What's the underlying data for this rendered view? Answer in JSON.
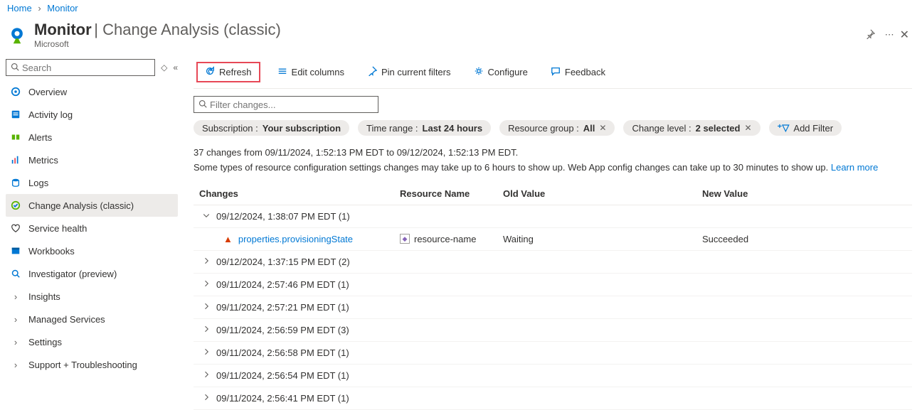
{
  "breadcrumb": {
    "home": "Home",
    "monitor": "Monitor"
  },
  "header": {
    "title": "Monitor",
    "subtitle": "Change Analysis (classic)",
    "publisher": "Microsoft"
  },
  "sidebar": {
    "searchPlaceholder": "Search",
    "items": [
      {
        "icon": "overview",
        "label": "Overview"
      },
      {
        "icon": "activity",
        "label": "Activity log"
      },
      {
        "icon": "alerts",
        "label": "Alerts"
      },
      {
        "icon": "metrics",
        "label": "Metrics"
      },
      {
        "icon": "logs",
        "label": "Logs"
      },
      {
        "icon": "change",
        "label": "Change Analysis (classic)",
        "active": true
      },
      {
        "icon": "health",
        "label": "Service health"
      },
      {
        "icon": "workbooks",
        "label": "Workbooks"
      },
      {
        "icon": "investigator",
        "label": "Investigator (preview)"
      },
      {
        "icon": "chevron",
        "label": "Insights"
      },
      {
        "icon": "chevron",
        "label": "Managed Services"
      },
      {
        "icon": "chevron",
        "label": "Settings"
      },
      {
        "icon": "chevron",
        "label": "Support + Troubleshooting"
      }
    ]
  },
  "toolbar": {
    "refresh": "Refresh",
    "editColumns": "Edit columns",
    "pinFilters": "Pin current filters",
    "configure": "Configure",
    "feedback": "Feedback"
  },
  "filterPlaceholder": "Filter changes...",
  "pills": {
    "subscriptionLabel": "Subscription : ",
    "subscriptionValue": "Your subscription",
    "timeRangeLabel": "Time range : ",
    "timeRangeValue": "Last 24 hours",
    "resourceGroupLabel": "Resource group : ",
    "resourceGroupValue": "All",
    "changeLevelLabel": "Change level : ",
    "changeLevelValue": "2 selected",
    "addFilter": "Add Filter"
  },
  "info": {
    "line1": "37 changes from 09/11/2024, 1:52:13 PM EDT to 09/12/2024, 1:52:13 PM EDT.",
    "line2": "Some types of resource configuration settings changes may take up to 6 hours to show up. Web App config changes can take up to 30 minutes to show up. ",
    "learnMore": "Learn more"
  },
  "columns": {
    "changes": "Changes",
    "resourceName": "Resource Name",
    "oldValue": "Old Value",
    "newValue": "New Value"
  },
  "groups": [
    {
      "timestamp": "09/12/2024, 1:38:07 PM EDT (1)",
      "expanded": true,
      "detail": {
        "property": "properties.provisioningState",
        "resourceName": "resource-name",
        "oldValue": "Waiting",
        "newValue": "Succeeded"
      }
    },
    {
      "timestamp": "09/12/2024, 1:37:15 PM EDT (2)"
    },
    {
      "timestamp": "09/11/2024, 2:57:46 PM EDT (1)"
    },
    {
      "timestamp": "09/11/2024, 2:57:21 PM EDT (1)"
    },
    {
      "timestamp": "09/11/2024, 2:56:59 PM EDT (3)"
    },
    {
      "timestamp": "09/11/2024, 2:56:58 PM EDT (1)"
    },
    {
      "timestamp": "09/11/2024, 2:56:54 PM EDT (1)"
    },
    {
      "timestamp": "09/11/2024, 2:56:41 PM EDT (1)"
    }
  ]
}
